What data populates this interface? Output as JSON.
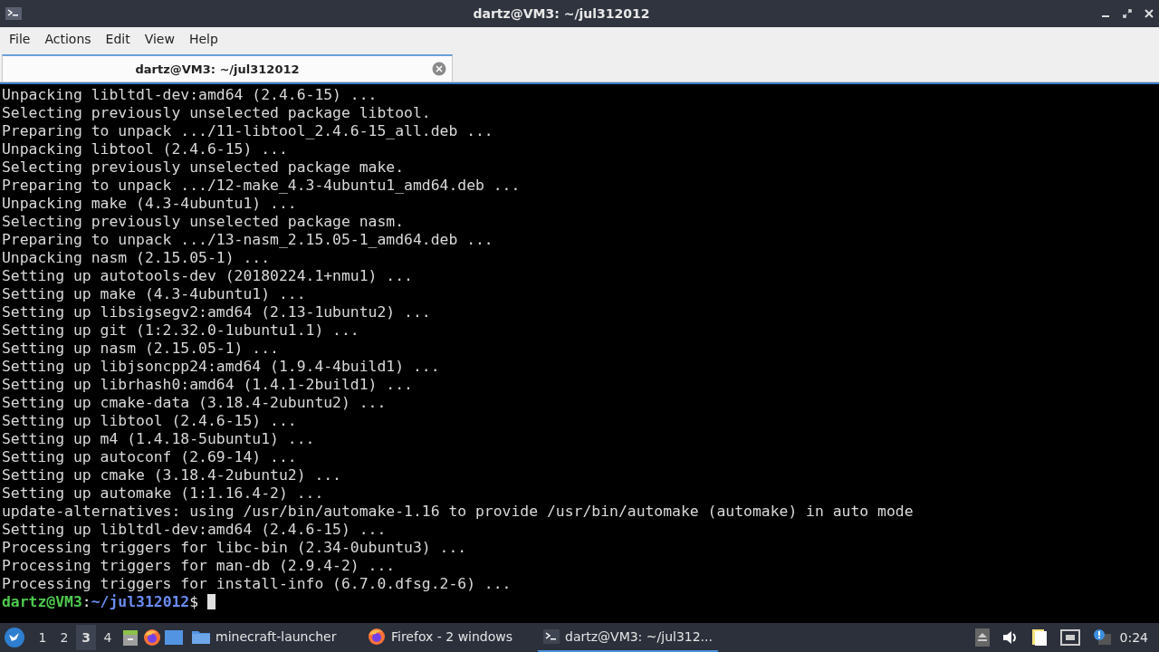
{
  "window": {
    "title": "dartz@VM3: ~/jul312012"
  },
  "menu": [
    "File",
    "Actions",
    "Edit",
    "View",
    "Help"
  ],
  "tabs": [
    {
      "label": "dartz@VM3: ~/jul312012",
      "selected": true
    }
  ],
  "terminal": {
    "lines": [
      "Unpacking libltdl-dev:amd64 (2.4.6-15) ...",
      "Selecting previously unselected package libtool.",
      "Preparing to unpack .../11-libtool_2.4.6-15_all.deb ...",
      "Unpacking libtool (2.4.6-15) ...",
      "Selecting previously unselected package make.",
      "Preparing to unpack .../12-make_4.3-4ubuntu1_amd64.deb ...",
      "Unpacking make (4.3-4ubuntu1) ...",
      "Selecting previously unselected package nasm.",
      "Preparing to unpack .../13-nasm_2.15.05-1_amd64.deb ...",
      "Unpacking nasm (2.15.05-1) ...",
      "Setting up autotools-dev (20180224.1+nmu1) ...",
      "Setting up make (4.3-4ubuntu1) ...",
      "Setting up libsigsegv2:amd64 (2.13-1ubuntu2) ...",
      "Setting up git (1:2.32.0-1ubuntu1.1) ...",
      "Setting up nasm (2.15.05-1) ...",
      "Setting up libjsoncpp24:amd64 (1.9.4-4build1) ...",
      "Setting up librhash0:amd64 (1.4.1-2build1) ...",
      "Setting up cmake-data (3.18.4-2ubuntu2) ...",
      "Setting up libtool (2.4.6-15) ...",
      "Setting up m4 (1.4.18-5ubuntu1) ...",
      "Setting up autoconf (2.69-14) ...",
      "Setting up cmake (3.18.4-2ubuntu2) ...",
      "Setting up automake (1:1.16.4-2) ...",
      "update-alternatives: using /usr/bin/automake-1.16 to provide /usr/bin/automake (automake) in auto mode",
      "Setting up libltdl-dev:amd64 (2.4.6-15) ...",
      "Processing triggers for libc-bin (2.34-0ubuntu3) ...",
      "Processing triggers for man-db (2.9.4-2) ...",
      "Processing triggers for install-info (6.7.0.dfsg.2-6) ..."
    ],
    "prompt": {
      "user_host": "dartz@VM3",
      "separator": ":",
      "path": "~/jul312012",
      "symbol": "$"
    }
  },
  "taskbar": {
    "workspaces": [
      {
        "label": "1",
        "selected": false
      },
      {
        "label": "2",
        "selected": false
      },
      {
        "label": "3",
        "selected": true
      },
      {
        "label": "4",
        "selected": false
      }
    ],
    "tasks": [
      {
        "kind": "folder",
        "label": "minecraft-launcher",
        "selected": false
      },
      {
        "kind": "firefox",
        "label": "Firefox - 2 windows",
        "selected": false
      },
      {
        "kind": "terminal",
        "label": "dartz@VM3: ~/jul312...",
        "selected": true
      }
    ],
    "clock": "0:24"
  }
}
